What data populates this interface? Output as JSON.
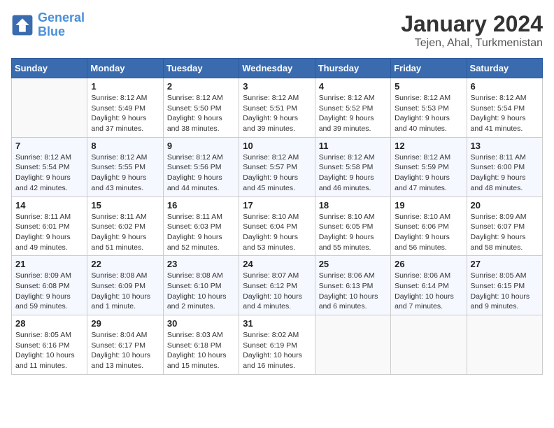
{
  "header": {
    "logo_line1": "General",
    "logo_line2": "Blue",
    "title": "January 2024",
    "subtitle": "Tejen, Ahal, Turkmenistan"
  },
  "columns": [
    "Sunday",
    "Monday",
    "Tuesday",
    "Wednesday",
    "Thursday",
    "Friday",
    "Saturday"
  ],
  "weeks": [
    [
      {
        "num": "",
        "info": ""
      },
      {
        "num": "1",
        "info": "Sunrise: 8:12 AM\nSunset: 5:49 PM\nDaylight: 9 hours\nand 37 minutes."
      },
      {
        "num": "2",
        "info": "Sunrise: 8:12 AM\nSunset: 5:50 PM\nDaylight: 9 hours\nand 38 minutes."
      },
      {
        "num": "3",
        "info": "Sunrise: 8:12 AM\nSunset: 5:51 PM\nDaylight: 9 hours\nand 39 minutes."
      },
      {
        "num": "4",
        "info": "Sunrise: 8:12 AM\nSunset: 5:52 PM\nDaylight: 9 hours\nand 39 minutes."
      },
      {
        "num": "5",
        "info": "Sunrise: 8:12 AM\nSunset: 5:53 PM\nDaylight: 9 hours\nand 40 minutes."
      },
      {
        "num": "6",
        "info": "Sunrise: 8:12 AM\nSunset: 5:54 PM\nDaylight: 9 hours\nand 41 minutes."
      }
    ],
    [
      {
        "num": "7",
        "info": "Sunrise: 8:12 AM\nSunset: 5:54 PM\nDaylight: 9 hours\nand 42 minutes."
      },
      {
        "num": "8",
        "info": "Sunrise: 8:12 AM\nSunset: 5:55 PM\nDaylight: 9 hours\nand 43 minutes."
      },
      {
        "num": "9",
        "info": "Sunrise: 8:12 AM\nSunset: 5:56 PM\nDaylight: 9 hours\nand 44 minutes."
      },
      {
        "num": "10",
        "info": "Sunrise: 8:12 AM\nSunset: 5:57 PM\nDaylight: 9 hours\nand 45 minutes."
      },
      {
        "num": "11",
        "info": "Sunrise: 8:12 AM\nSunset: 5:58 PM\nDaylight: 9 hours\nand 46 minutes."
      },
      {
        "num": "12",
        "info": "Sunrise: 8:12 AM\nSunset: 5:59 PM\nDaylight: 9 hours\nand 47 minutes."
      },
      {
        "num": "13",
        "info": "Sunrise: 8:11 AM\nSunset: 6:00 PM\nDaylight: 9 hours\nand 48 minutes."
      }
    ],
    [
      {
        "num": "14",
        "info": "Sunrise: 8:11 AM\nSunset: 6:01 PM\nDaylight: 9 hours\nand 49 minutes."
      },
      {
        "num": "15",
        "info": "Sunrise: 8:11 AM\nSunset: 6:02 PM\nDaylight: 9 hours\nand 51 minutes."
      },
      {
        "num": "16",
        "info": "Sunrise: 8:11 AM\nSunset: 6:03 PM\nDaylight: 9 hours\nand 52 minutes."
      },
      {
        "num": "17",
        "info": "Sunrise: 8:10 AM\nSunset: 6:04 PM\nDaylight: 9 hours\nand 53 minutes."
      },
      {
        "num": "18",
        "info": "Sunrise: 8:10 AM\nSunset: 6:05 PM\nDaylight: 9 hours\nand 55 minutes."
      },
      {
        "num": "19",
        "info": "Sunrise: 8:10 AM\nSunset: 6:06 PM\nDaylight: 9 hours\nand 56 minutes."
      },
      {
        "num": "20",
        "info": "Sunrise: 8:09 AM\nSunset: 6:07 PM\nDaylight: 9 hours\nand 58 minutes."
      }
    ],
    [
      {
        "num": "21",
        "info": "Sunrise: 8:09 AM\nSunset: 6:08 PM\nDaylight: 9 hours\nand 59 minutes."
      },
      {
        "num": "22",
        "info": "Sunrise: 8:08 AM\nSunset: 6:09 PM\nDaylight: 10 hours\nand 1 minute."
      },
      {
        "num": "23",
        "info": "Sunrise: 8:08 AM\nSunset: 6:10 PM\nDaylight: 10 hours\nand 2 minutes."
      },
      {
        "num": "24",
        "info": "Sunrise: 8:07 AM\nSunset: 6:12 PM\nDaylight: 10 hours\nand 4 minutes."
      },
      {
        "num": "25",
        "info": "Sunrise: 8:06 AM\nSunset: 6:13 PM\nDaylight: 10 hours\nand 6 minutes."
      },
      {
        "num": "26",
        "info": "Sunrise: 8:06 AM\nSunset: 6:14 PM\nDaylight: 10 hours\nand 7 minutes."
      },
      {
        "num": "27",
        "info": "Sunrise: 8:05 AM\nSunset: 6:15 PM\nDaylight: 10 hours\nand 9 minutes."
      }
    ],
    [
      {
        "num": "28",
        "info": "Sunrise: 8:05 AM\nSunset: 6:16 PM\nDaylight: 10 hours\nand 11 minutes."
      },
      {
        "num": "29",
        "info": "Sunrise: 8:04 AM\nSunset: 6:17 PM\nDaylight: 10 hours\nand 13 minutes."
      },
      {
        "num": "30",
        "info": "Sunrise: 8:03 AM\nSunset: 6:18 PM\nDaylight: 10 hours\nand 15 minutes."
      },
      {
        "num": "31",
        "info": "Sunrise: 8:02 AM\nSunset: 6:19 PM\nDaylight: 10 hours\nand 16 minutes."
      },
      {
        "num": "",
        "info": ""
      },
      {
        "num": "",
        "info": ""
      },
      {
        "num": "",
        "info": ""
      }
    ]
  ]
}
